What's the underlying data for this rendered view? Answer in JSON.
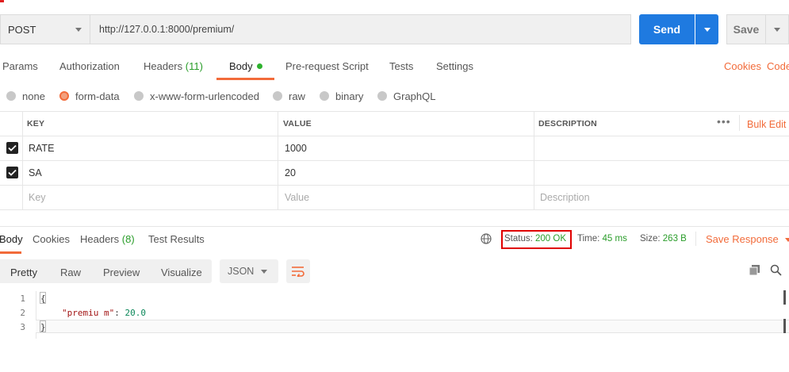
{
  "request": {
    "method": "POST",
    "url": "http://127.0.0.1:8000/premium/",
    "send_label": "Send",
    "save_label": "Save"
  },
  "request_tabs": {
    "params": "Params",
    "authorization": "Authorization",
    "headers": "Headers",
    "headers_count": "(11)",
    "body": "Body",
    "pre_request": "Pre-request Script",
    "tests": "Tests",
    "settings": "Settings",
    "cookies": "Cookies",
    "code": "Code"
  },
  "body_types": {
    "none": "none",
    "form_data": "form-data",
    "urlencoded": "x-www-form-urlencoded",
    "raw": "raw",
    "binary": "binary",
    "graphql": "GraphQL",
    "selected": "form-data"
  },
  "params_table": {
    "headers": {
      "key": "KEY",
      "value": "VALUE",
      "description": "DESCRIPTION"
    },
    "bulk_edit": "Bulk Edit",
    "more": "•••",
    "rows": [
      {
        "key": "RATE",
        "value": "1000",
        "description": ""
      },
      {
        "key": "SA",
        "value": "20",
        "description": ""
      }
    ],
    "placeholders": {
      "key": "Key",
      "value": "Value",
      "description": "Description"
    }
  },
  "response": {
    "tabs": {
      "body": "Body",
      "cookies": "Cookies",
      "headers": "Headers",
      "headers_count": "(8)",
      "test_results": "Test Results"
    },
    "status_label": "Status:",
    "status_value": "200 OK",
    "time_label": "Time:",
    "time_value": "45 ms",
    "size_label": "Size:",
    "size_value": "263 B",
    "save_response": "Save Response"
  },
  "view_toolbar": {
    "pretty": "Pretty",
    "raw": "Raw",
    "preview": "Preview",
    "visualize": "Visualize",
    "format": "JSON"
  },
  "code": {
    "line_numbers": [
      "1",
      "2",
      "3"
    ],
    "line1": "{",
    "line2_key": "\"premiu m\"",
    "line2_sep": ": ",
    "line2_value": "20.0",
    "line3": "}"
  },
  "colors": {
    "accent": "#f26b3a",
    "primary": "#1f7ae0",
    "success": "#2a9d2a",
    "highlight": "#e00000"
  }
}
